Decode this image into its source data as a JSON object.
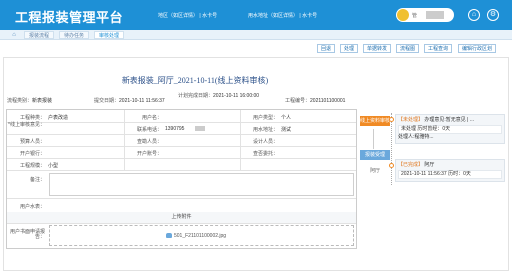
{
  "app": {
    "title": "工程报装管理平台",
    "marquee_left": "地区（如区详情）",
    "marquee_left_suffix": "| 水卡号",
    "marquee_right": "用水地址（如区详情）",
    "marquee_right_suffix": "| 水卡号",
    "user_label": "管"
  },
  "tabs": [
    {
      "label": "报装流程"
    },
    {
      "label": "待办任务"
    },
    {
      "label": "审核处理"
    }
  ],
  "toolbar": [
    "回退",
    "处理",
    "单据转发",
    "流程图",
    "工程查询",
    "编辑行政区划"
  ],
  "document": {
    "title": "新表报装_阿厅_2021-10-11(线上资料审核)",
    "meta": {
      "flow_type_label": "流程类别：",
      "flow_type_value": "新表报装",
      "submit_date_label": "提交日期：",
      "submit_date_value": "2021-10-11 11:56:37",
      "plan_done_label": "计划完成日期：",
      "plan_done_value": "2021-10-11 16:00:00",
      "project_no_label": "工程编号：",
      "project_no_value": "2021101100001"
    }
  },
  "form": {
    "row1": {
      "a_label": "工程种类：",
      "a_value": "户表改造",
      "b_label": "用户名：",
      "b_value": "",
      "c_label": "用户类型：",
      "c_value": "个人"
    },
    "row2": {
      "a_label": "*线上审核意见：",
      "b_label": "联系电话：",
      "b_value": "1390795",
      "c_label": "用水地址：",
      "c_value": "测试"
    },
    "row3": {
      "a_label": "预算人员：",
      "b_label": "查勘人员：",
      "c_label": "设计人员："
    },
    "row4": {
      "a_label": "开户银行：",
      "b_label": "开户账号：",
      "c_label": "查否委托："
    },
    "row5": {
      "a_label": "工程规模：",
      "a_value": "小型"
    },
    "note_label": "备注：",
    "water_source_label": "用户水表：",
    "attachment_header": "上传附件",
    "attachment_label": "用户书面申请报告：",
    "attachment_file": "501_F21101100002.jpg"
  },
  "flow": {
    "step1": "线上资料审核",
    "step2": "报装受理",
    "step2_sub": "阿厅",
    "timeline": [
      {
        "status": "【未处理】",
        "desc": "办理意见:暂无意见 | ...",
        "handler": "未处理 历时曾经：0天",
        "note": "处理人:程雅特..."
      },
      {
        "status": "【已完成】",
        "desc": "阿厅",
        "time": "2021-10-11 11:56:37 历时：0天"
      }
    ]
  },
  "colors": {
    "brand": "#1e90d6",
    "flow_active": "#f08a24",
    "flow_done": "#6aa8dc"
  }
}
